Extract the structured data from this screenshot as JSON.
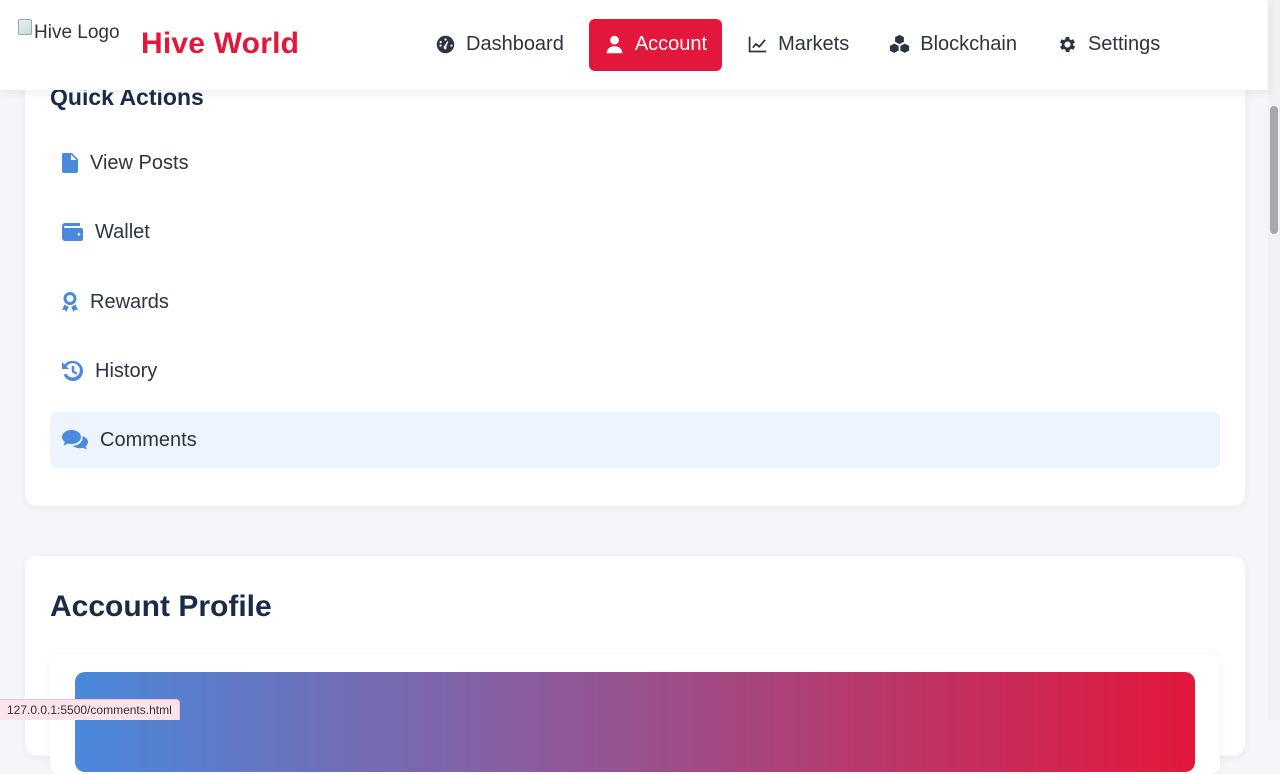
{
  "header": {
    "logo_alt": "Hive Logo",
    "brand": "Hive World"
  },
  "nav": {
    "items": [
      {
        "label": "Dashboard",
        "icon": "gauge-icon",
        "active": false
      },
      {
        "label": "Account",
        "icon": "user-icon",
        "active": true
      },
      {
        "label": "Markets",
        "icon": "chart-line-icon",
        "active": false
      },
      {
        "label": "Blockchain",
        "icon": "cubes-icon",
        "active": false
      },
      {
        "label": "Settings",
        "icon": "gear-icon",
        "active": false
      }
    ]
  },
  "quick_actions": {
    "title": "Quick Actions",
    "items": [
      {
        "label": "View Posts",
        "icon": "file-alt-icon"
      },
      {
        "label": "Wallet",
        "icon": "wallet-icon"
      },
      {
        "label": "Rewards",
        "icon": "award-icon"
      },
      {
        "label": "History",
        "icon": "history-icon"
      },
      {
        "label": "Comments",
        "icon": "comments-icon",
        "hovered": true
      }
    ]
  },
  "profile": {
    "title": "Account Profile"
  },
  "status_bar": {
    "url": "127.0.0.1:5500/comments.html"
  },
  "colors": {
    "brand": "#e3173c",
    "accent": "#4a89dc",
    "heading": "#1a2b4a",
    "hover_bg": "#edf4fd"
  }
}
